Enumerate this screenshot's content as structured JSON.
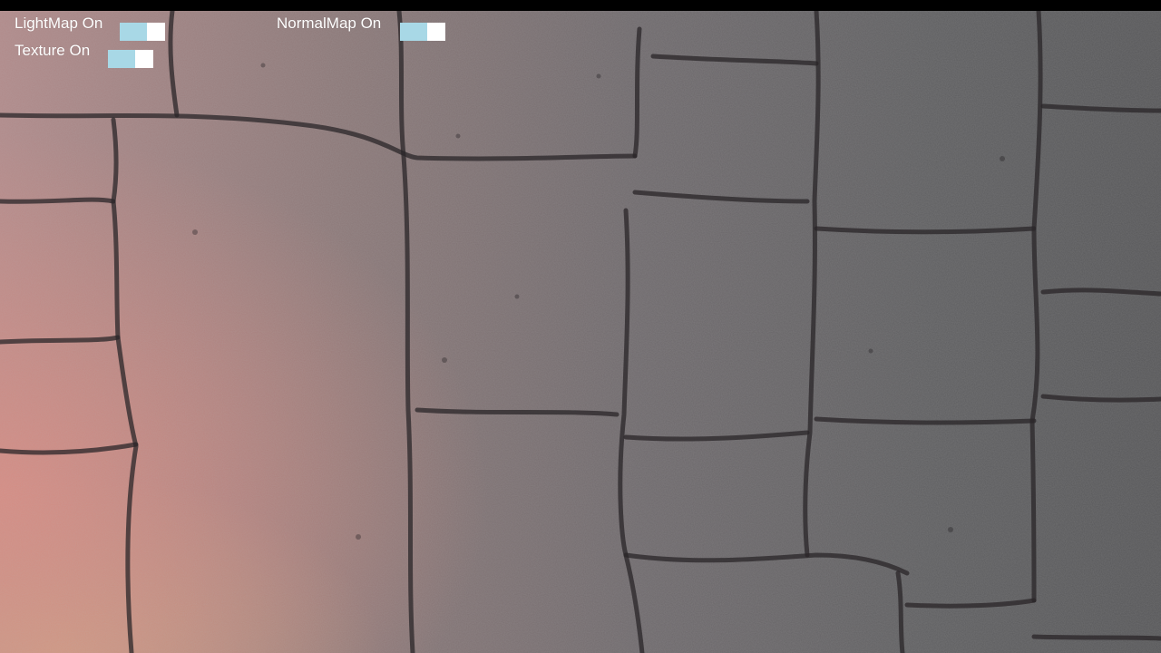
{
  "hud": {
    "lightmap": {
      "label": "LightMap On",
      "on": true
    },
    "normalmap": {
      "label": "NormalMap On",
      "on": true
    },
    "texture": {
      "label": "Texture On",
      "on": true
    }
  },
  "colors": {
    "toggle_on": "#a8d8e6",
    "toggle_track": "#ffffff",
    "label": "#ffffff"
  },
  "scene": {
    "description_icon": "cobblestone-normalmap-render"
  }
}
